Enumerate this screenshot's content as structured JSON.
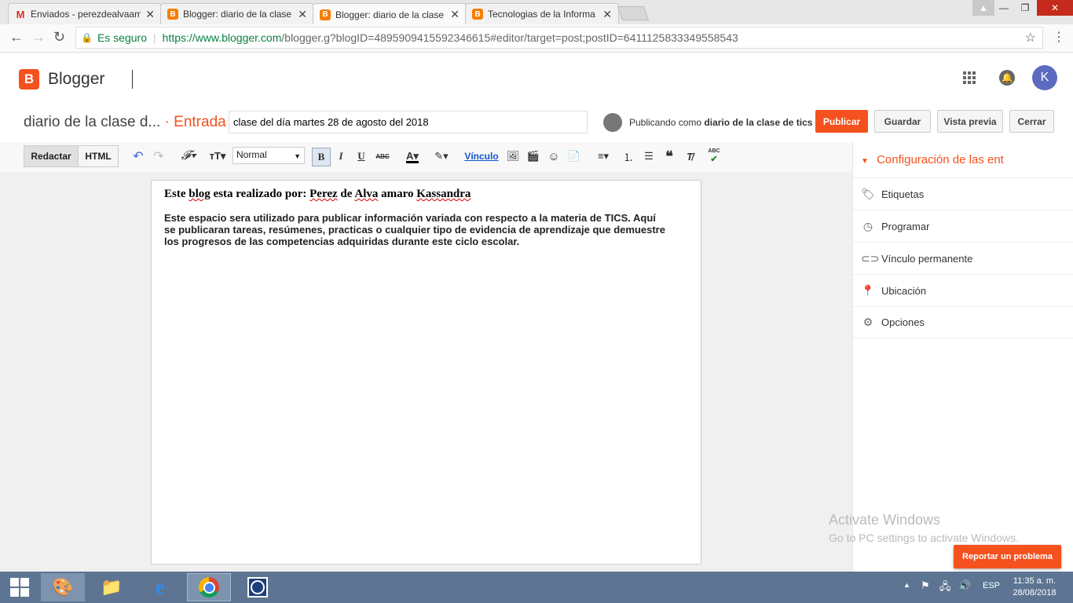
{
  "browser": {
    "tabs": [
      {
        "title": "Enviados - perezdealvaam",
        "favicon": "gmail-icon"
      },
      {
        "title": "Blogger: diario de la clase",
        "favicon": "blogger-icon"
      },
      {
        "title": "Blogger: diario de la clase",
        "favicon": "blogger-icon",
        "active": true
      },
      {
        "title": "Tecnologias de la Informa",
        "favicon": "blogger-icon"
      }
    ],
    "secure_label": "Es seguro",
    "url_host": "https://www.blogger.com",
    "url_path": "/blogger.g?blogID=4895909415592346615#editor/target=post;postID=6411125833349558543"
  },
  "header": {
    "logo_letter": "B",
    "brand": "Blogger",
    "avatar_letter": "K"
  },
  "post": {
    "blog_name": "diario de la clase d...",
    "separator": "·",
    "type_label": "Entrada",
    "title_value": "clase del día martes 28 de agosto del 2018",
    "publishing_as_prefix": "Publicando como",
    "publishing_as_name": "diario de la clase de tics",
    "buttons": {
      "publish": "Publicar",
      "save": "Guardar",
      "preview": "Vista previa",
      "close": "Cerrar"
    }
  },
  "toolbar": {
    "compose": "Redactar",
    "html": "HTML",
    "format_value": "Normal",
    "bold": "B",
    "italic": "I",
    "underline": "U",
    "strike": "ABC",
    "link": "Vínculo",
    "spell": "ABC"
  },
  "editor": {
    "heading_prefix": "Este",
    "heading_w1": "blog",
    "heading_mid": "esta realizado por:",
    "heading_w2": "Perez",
    "heading_de": "de",
    "heading_w3": "Alva",
    "heading_amaro": "amaro",
    "heading_w4": "Kassandra",
    "body_line1": "Este espacio sera utilizado para publicar información variada con respecto a la materia de TICS. Aquí",
    "body_line2": "se publicaran tareas, resúmenes, practicas o cualquier tipo de evidencia de aprendizaje que demuestre",
    "body_line3": "los progresos de las competencias adquiridas durante este ciclo escolar."
  },
  "sidebar": {
    "title": "Configuración de las ent",
    "items": [
      {
        "label": "Etiquetas",
        "icon": "tag-icon"
      },
      {
        "label": "Programar",
        "icon": "clock-icon"
      },
      {
        "label": "Vínculo permanente",
        "icon": "link-icon"
      },
      {
        "label": "Ubicación",
        "icon": "location-pin-icon"
      },
      {
        "label": "Opciones",
        "icon": "gear-icon"
      }
    ]
  },
  "watermark": {
    "line1": "Activate Windows",
    "line2": "Go to PC settings to activate Windows."
  },
  "report_button": "Reportar un problema",
  "taskbar": {
    "lang": "ESP",
    "time": "11:35 a. m.",
    "date": "28/08/2018"
  },
  "colors": {
    "accent": "#f4511e",
    "taskbar": "#5d7592",
    "avatar": "#5c6bc0"
  }
}
